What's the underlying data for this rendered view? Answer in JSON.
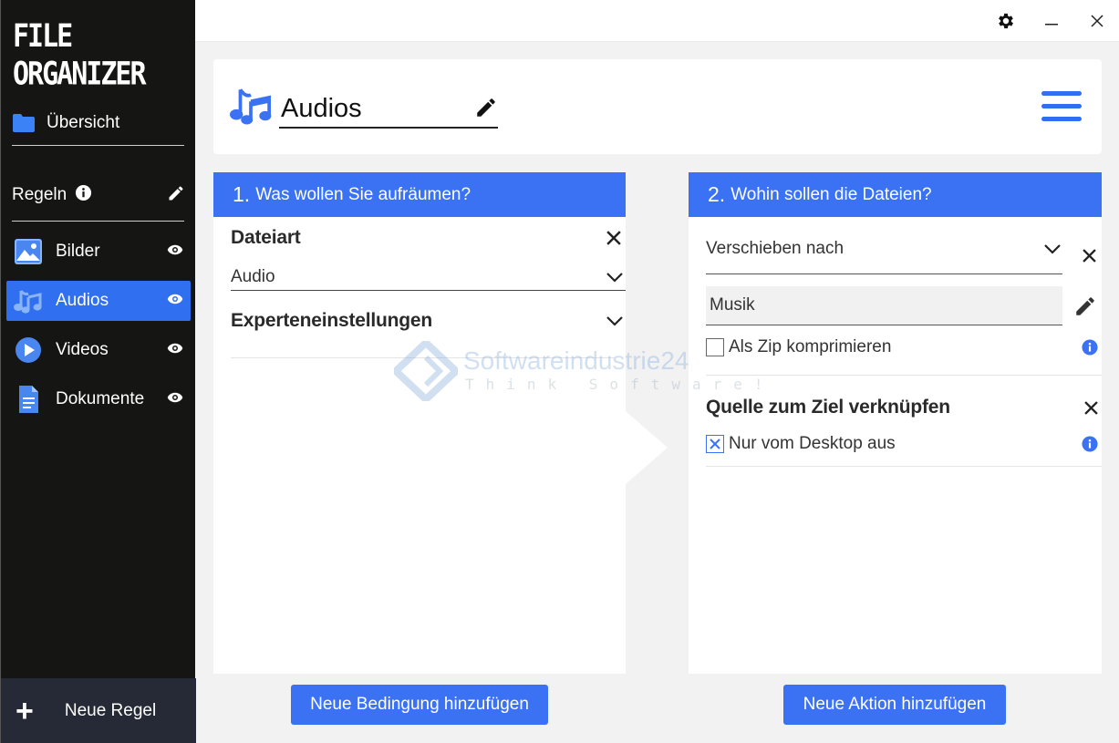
{
  "app": {
    "logo_line1": "FILE",
    "logo_line2": "ORGANIZER"
  },
  "sidebar": {
    "overview_label": "Übersicht",
    "rules_label": "Regeln",
    "items": [
      {
        "label": "Bilder",
        "icon": "image-icon",
        "active": false
      },
      {
        "label": "Audios",
        "icon": "music-icon",
        "active": true
      },
      {
        "label": "Videos",
        "icon": "play-circle-icon",
        "active": false
      },
      {
        "label": "Dokumente",
        "icon": "document-icon",
        "active": false
      }
    ],
    "new_rule_label": "Neue Regel"
  },
  "header": {
    "title": "Audios"
  },
  "conditions_panel": {
    "number": "1.",
    "heading": "Was wollen Sie aufräumen?",
    "filetype_title": "Dateiart",
    "filetype_value": "Audio",
    "expert_label": "Experteneinstellungen",
    "add_button": "Neue Bedingung hinzufügen"
  },
  "actions_panel": {
    "number": "2.",
    "heading": "Wohin sollen die Dateien?",
    "action_value": "Verschieben nach",
    "target_folder": "Musik",
    "zip_label": "Als Zip komprimieren",
    "zip_checked": false,
    "link_title": "Quelle zum Ziel verknüpfen",
    "desktop_label": "Nur vom Desktop aus",
    "desktop_checked": true,
    "add_button": "Neue Aktion hinzufügen"
  },
  "watermark": {
    "text": "Softwareindustrie24",
    "sub": "Think Software!"
  },
  "colors": {
    "accent": "#3b72f4",
    "sidebar_bg": "#151513",
    "active_item": "#2f6ff0"
  }
}
